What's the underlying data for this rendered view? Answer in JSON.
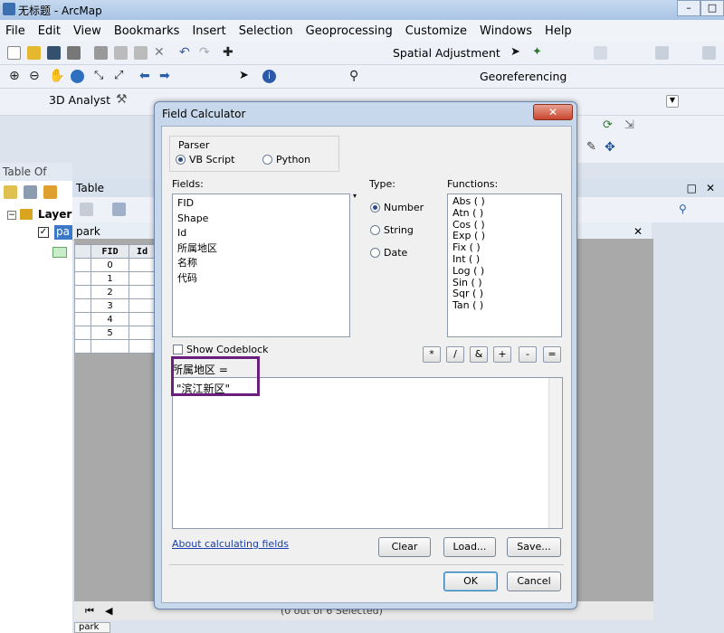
{
  "window": {
    "title": "无标题 - ArcMap"
  },
  "menu": [
    "File",
    "Edit",
    "View",
    "Bookmarks",
    "Insert",
    "Selection",
    "Geoprocessing",
    "Customize",
    "Windows",
    "Help"
  ],
  "toolbars": {
    "spatial_adjustment": "Spatial Adjustment",
    "georeferencing": "Georeferencing",
    "analyst": "3D Analyst"
  },
  "toc": {
    "title": "Table Of Contents",
    "layers": "Layers",
    "layer_name": "pa"
  },
  "table": {
    "title": "Table",
    "tab": "park",
    "columns": [
      "FID",
      "Id"
    ],
    "rows": [
      "0",
      "1",
      "2",
      "3",
      "4",
      "5"
    ],
    "status": "(0 out of 6 Selected)",
    "bottom_tab": "park"
  },
  "dialog": {
    "title": "Field Calculator",
    "parser_label": "Parser",
    "parser_options": [
      "VB Script",
      "Python"
    ],
    "fields_label": "Fields:",
    "fields": [
      "FID",
      "Shape",
      "Id",
      "所属地区",
      "名称",
      "代码"
    ],
    "type_label": "Type:",
    "types": [
      "Number",
      "String",
      "Date"
    ],
    "functions_label": "Functions:",
    "functions": [
      "Abs ( )",
      "Atn ( )",
      "Cos ( )",
      "Exp ( )",
      "Fix ( )",
      "Int ( )",
      "Log ( )",
      "Sin ( )",
      "Sqr ( )",
      "Tan ( )"
    ],
    "operators": [
      "*",
      "/",
      "&",
      "+",
      "-",
      "="
    ],
    "show_codeblock": "Show Codeblock",
    "expression_label": "所属地区 =",
    "expression": "\"滨江新区\"",
    "about_link": "About calculating fields",
    "buttons": {
      "clear": "Clear",
      "load": "Load...",
      "save": "Save...",
      "ok": "OK",
      "cancel": "Cancel"
    }
  }
}
